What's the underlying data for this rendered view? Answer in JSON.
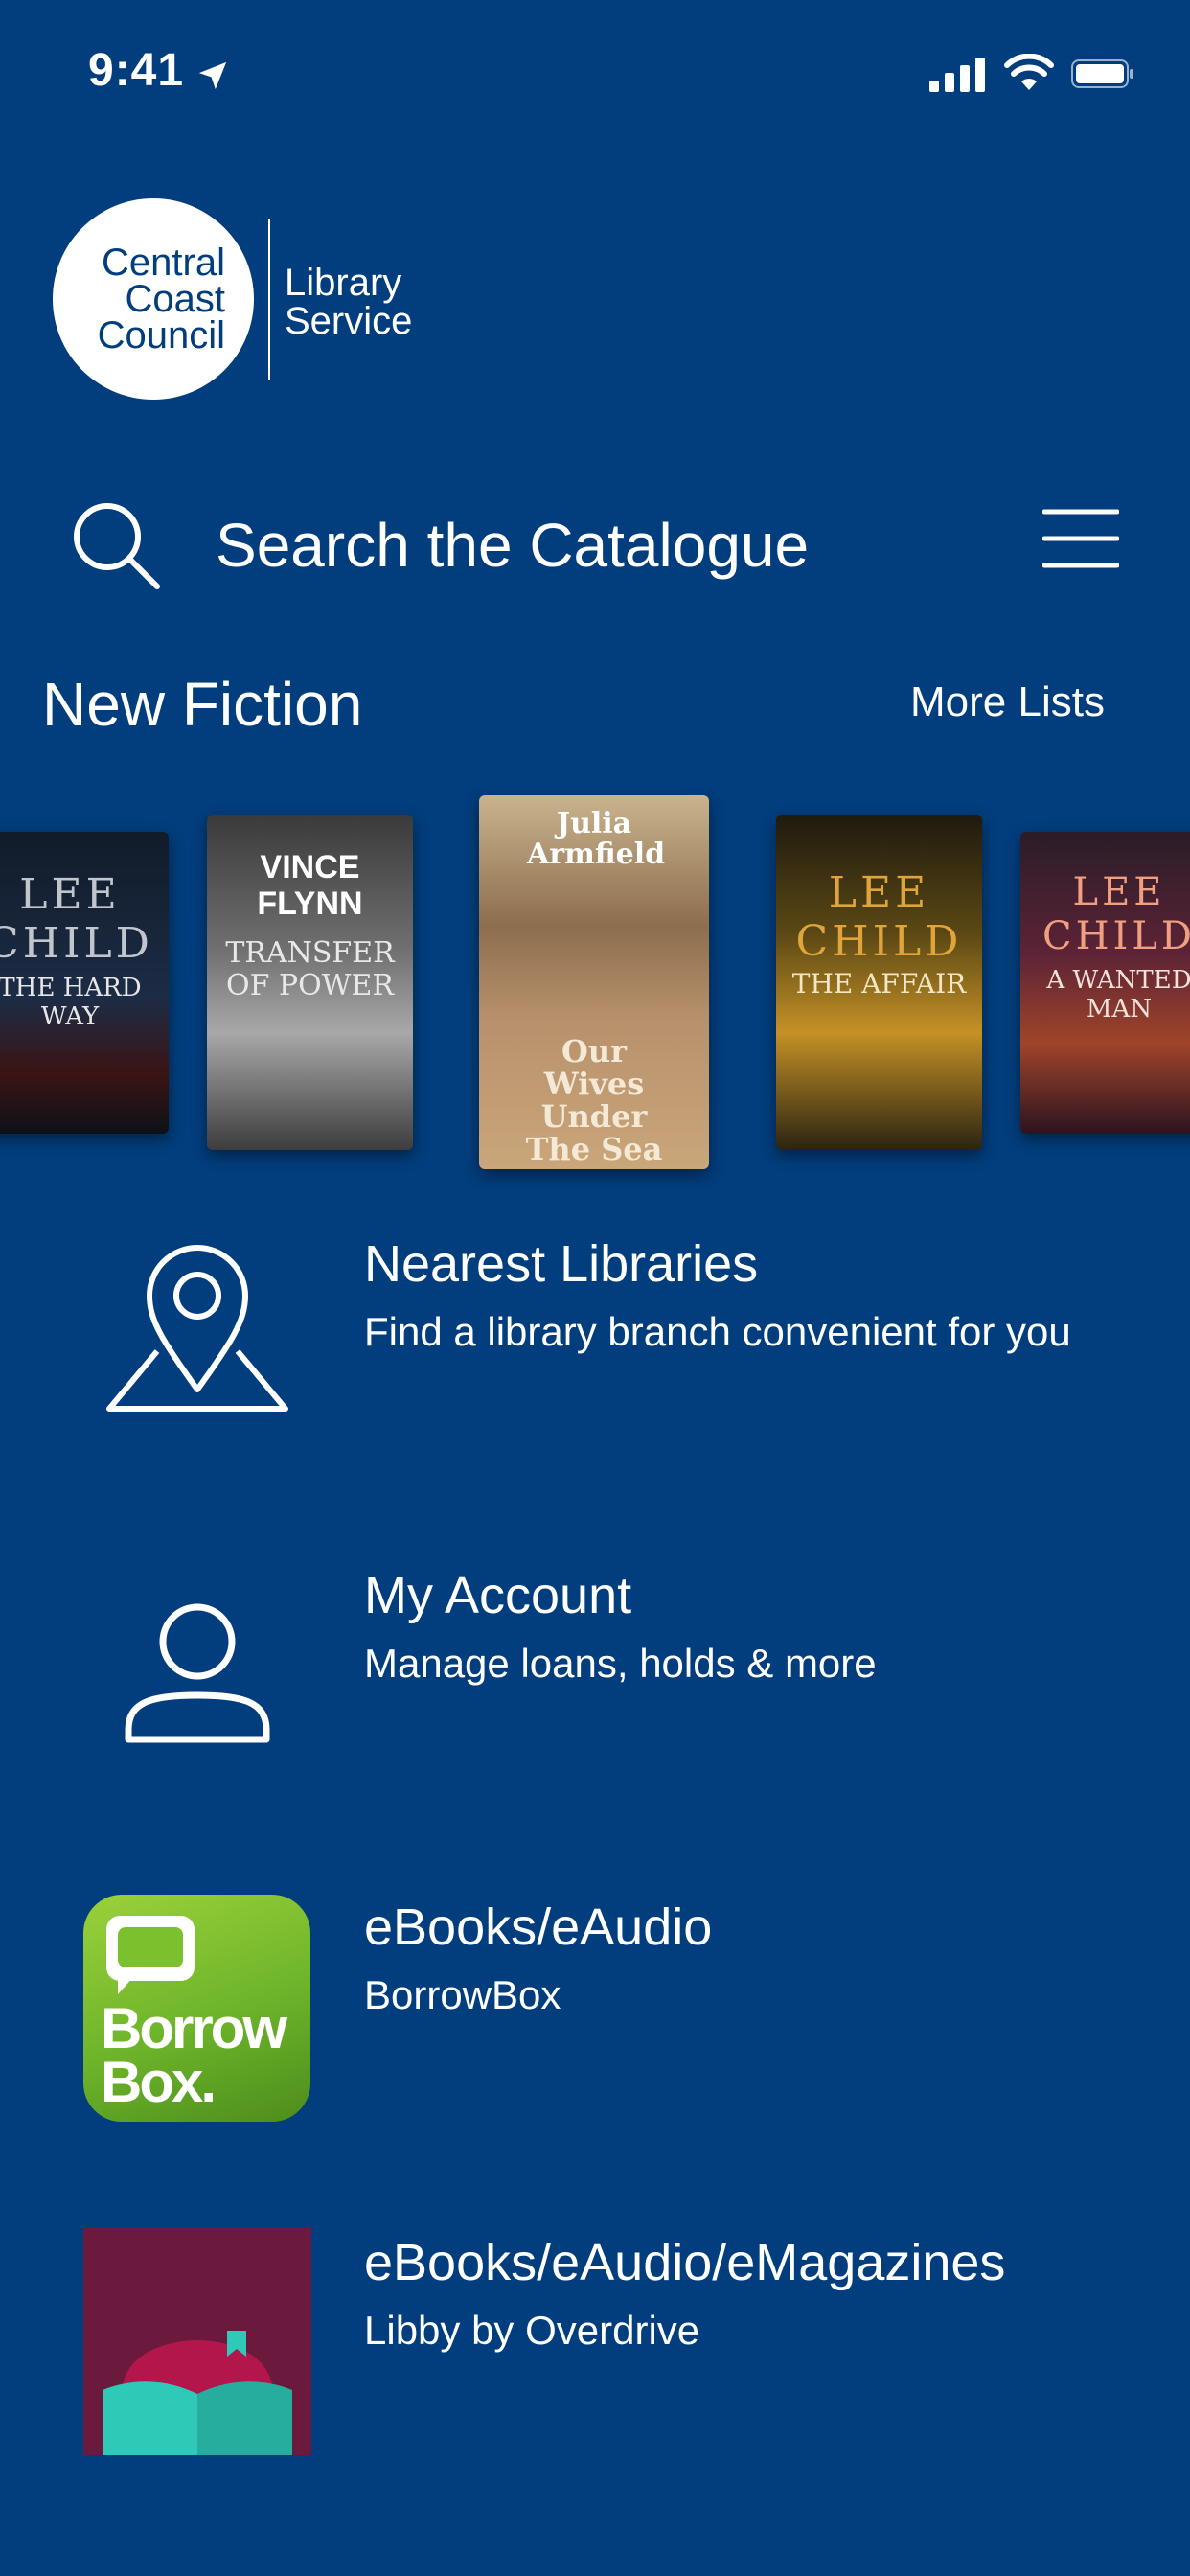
{
  "status_bar": {
    "time": "9:41"
  },
  "logo": {
    "council_lines": [
      "Central",
      "Coast",
      "Council"
    ],
    "service_lines": [
      "Library",
      "Service"
    ]
  },
  "search": {
    "placeholder": "Search the Catalogue"
  },
  "new_fiction": {
    "title": "New Fiction",
    "more_label": "More Lists",
    "books": [
      {
        "author": "LEE CHILD",
        "title": "THE HARD WAY"
      },
      {
        "author": "VINCE FLYNN",
        "title": "TRANSFER OF POWER"
      },
      {
        "author": "Julia Armfield",
        "title": "Our Wives Under The Sea"
      },
      {
        "author": "LEE CHILD",
        "title": "THE AFFAIR"
      },
      {
        "author": "LEE CHILD",
        "title": "A WANTED MAN"
      }
    ]
  },
  "menu_items": [
    {
      "title": "Nearest Libraries",
      "subtitle": "Find a library branch convenient for you",
      "icon": "map-pin-icon"
    },
    {
      "title": "My Account",
      "subtitle": "Manage loans, holds & more",
      "icon": "person-icon"
    },
    {
      "title": "eBooks/eAudio",
      "subtitle": "BorrowBox",
      "icon": "borrowbox-app-icon",
      "icon_text": [
        "Borrow",
        "Box."
      ]
    },
    {
      "title": "eBooks/eAudio/eMagazines",
      "subtitle": "Libby by Overdrive",
      "icon": "libby-app-icon"
    }
  ],
  "colors": {
    "background": "#023e7d",
    "foreground": "#ffffff"
  }
}
